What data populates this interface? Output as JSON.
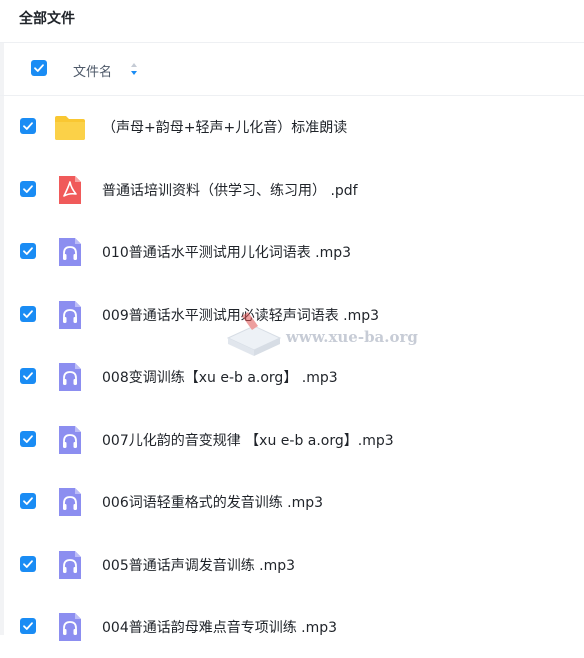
{
  "page_title": "全部文件",
  "header": {
    "name_label": "文件名"
  },
  "colors": {
    "accent": "#1a8cf4",
    "folder": "#f9c732",
    "pdf": "#f05a5a",
    "audio": "#8c8ef0"
  },
  "files": [
    {
      "name": "（声母+韵母+轻声+儿化音）标准朗读",
      "type": "folder",
      "checked": true
    },
    {
      "name": "普通话培训资料（供学习、练习用） .pdf",
      "type": "pdf",
      "checked": true
    },
    {
      "name": "010普通话水平测试用儿化词语表 .mp3",
      "type": "audio",
      "checked": true
    },
    {
      "name": "009普通话水平测试用必读轻声词语表 .mp3",
      "type": "audio",
      "checked": true
    },
    {
      "name": "008变调训练【xu e-b a.org】 .mp3",
      "type": "audio",
      "checked": true
    },
    {
      "name": "007儿化韵的音变规律 【xu e-b a.org】.mp3",
      "type": "audio",
      "checked": true
    },
    {
      "name": "006词语轻重格式的发音训练 .mp3",
      "type": "audio",
      "checked": true
    },
    {
      "name": "005普通话声调发音训练 .mp3",
      "type": "audio",
      "checked": true
    },
    {
      "name": "004普通话韵母难点音专项训练 .mp3",
      "type": "audio",
      "checked": true
    }
  ],
  "watermark": {
    "text": "www.xue-ba.org"
  }
}
